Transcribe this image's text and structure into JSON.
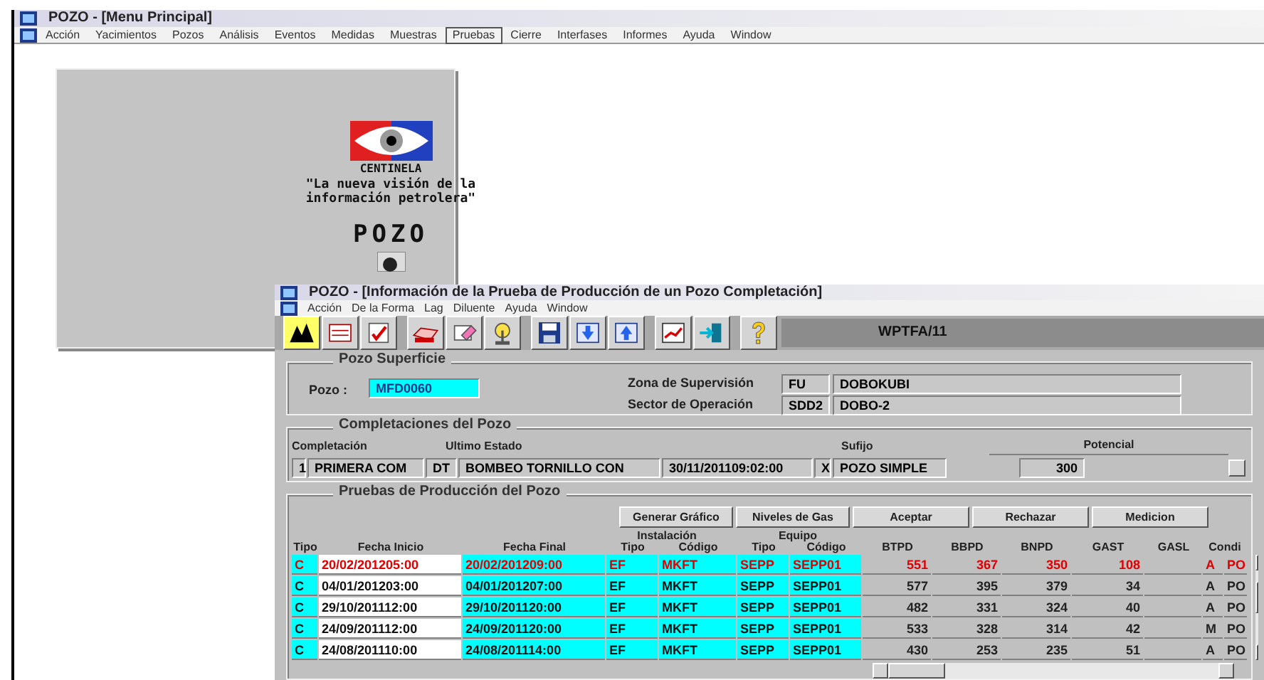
{
  "main_window": {
    "title": "POZO - [Menu Principal]",
    "menu": [
      {
        "label": "Acción",
        "selected": false
      },
      {
        "label": "Yacimientos",
        "selected": false
      },
      {
        "label": "Pozos",
        "selected": false
      },
      {
        "label": "Análisis",
        "selected": false
      },
      {
        "label": "Eventos",
        "selected": false
      },
      {
        "label": "Medidas",
        "selected": false
      },
      {
        "label": "Muestras",
        "selected": false
      },
      {
        "label": "Pruebas",
        "selected": true
      },
      {
        "label": "Cierre",
        "selected": false
      },
      {
        "label": "Interfases",
        "selected": false
      },
      {
        "label": "Informes",
        "selected": false
      },
      {
        "label": "Ayuda",
        "selected": false
      },
      {
        "label": "Window",
        "selected": false
      }
    ]
  },
  "splash": {
    "brand": "CENTINELA",
    "slogan_1": "\"La nueva visión de la",
    "slogan_2": "información petrolera\"",
    "app_name": "POZO"
  },
  "form_window": {
    "title": "POZO - [Información de la Prueba de Producción de un Pozo Completación]",
    "menu": [
      "Acción",
      "De la Forma",
      "Lag",
      "Diluente",
      "Ayuda",
      "Window"
    ],
    "form_code": "WPTFA/11"
  },
  "pozo_superficie": {
    "title": "Pozo Superficie",
    "pozo_label": "Pozo :",
    "pozo": "MFD0060",
    "zona_label": "Zona de Supervisión",
    "zona_code": "FU",
    "zona_name": "DOBOKUBI",
    "sector_label": "Sector de Operación",
    "sector_code": "SDD2",
    "sector_name": "DOBO-2"
  },
  "completaciones": {
    "title": "Completaciones del Pozo",
    "headers": [
      "Completación",
      "Ultimo Estado",
      "Sufijo",
      "Potencial"
    ],
    "row": {
      "num": "1",
      "name": "PRIMERA COM",
      "estado_code": "DT",
      "estado": "BOMBEO TORNILLO CON",
      "fecha": "30/11/201109:02:00",
      "sufijo_code": "X",
      "sufijo": "POZO SIMPLE",
      "potencial": "300"
    }
  },
  "pruebas": {
    "title": "Pruebas de Producción del Pozo",
    "buttons": [
      "Generar Gráfico",
      "Niveles de Gas",
      "Aceptar",
      "Rechazar",
      "Medicion"
    ],
    "group_headers": [
      "Instalación",
      "Equipo"
    ],
    "columns": [
      "Tipo",
      "Fecha Inicio",
      "Fecha Final",
      "Tipo",
      "Código",
      "Tipo",
      "Código",
      "BTPD",
      "BBPD",
      "BNPD",
      "GAST",
      "GASL",
      "Condi"
    ],
    "rows": [
      {
        "alert": true,
        "cells": [
          "C",
          "20/02/201205:00",
          "20/02/201209:00",
          "EF",
          "MKFT",
          "SEPP",
          "SEPP01",
          "551",
          "367",
          "350",
          "108",
          "",
          "A",
          "PO"
        ]
      },
      {
        "alert": false,
        "cells": [
          "C",
          "04/01/201203:00",
          "04/01/201207:00",
          "EF",
          "MKFT",
          "SEPP",
          "SEPP01",
          "577",
          "395",
          "379",
          "34",
          "",
          "A",
          "PO"
        ]
      },
      {
        "alert": false,
        "cells": [
          "C",
          "29/10/201112:00",
          "29/10/201120:00",
          "EF",
          "MKFT",
          "SEPP",
          "SEPP01",
          "482",
          "331",
          "324",
          "40",
          "",
          "A",
          "PO"
        ]
      },
      {
        "alert": false,
        "cells": [
          "C",
          "24/09/201112:00",
          "24/09/201120:00",
          "EF",
          "MKFT",
          "SEPP",
          "SEPP01",
          "533",
          "328",
          "314",
          "42",
          "",
          "M",
          "PO"
        ]
      },
      {
        "alert": false,
        "cells": [
          "C",
          "24/08/201110:00",
          "24/08/201114:00",
          "EF",
          "MKFT",
          "SEPP",
          "SEPP01",
          "430",
          "253",
          "235",
          "51",
          "",
          "A",
          "PO"
        ]
      }
    ]
  }
}
